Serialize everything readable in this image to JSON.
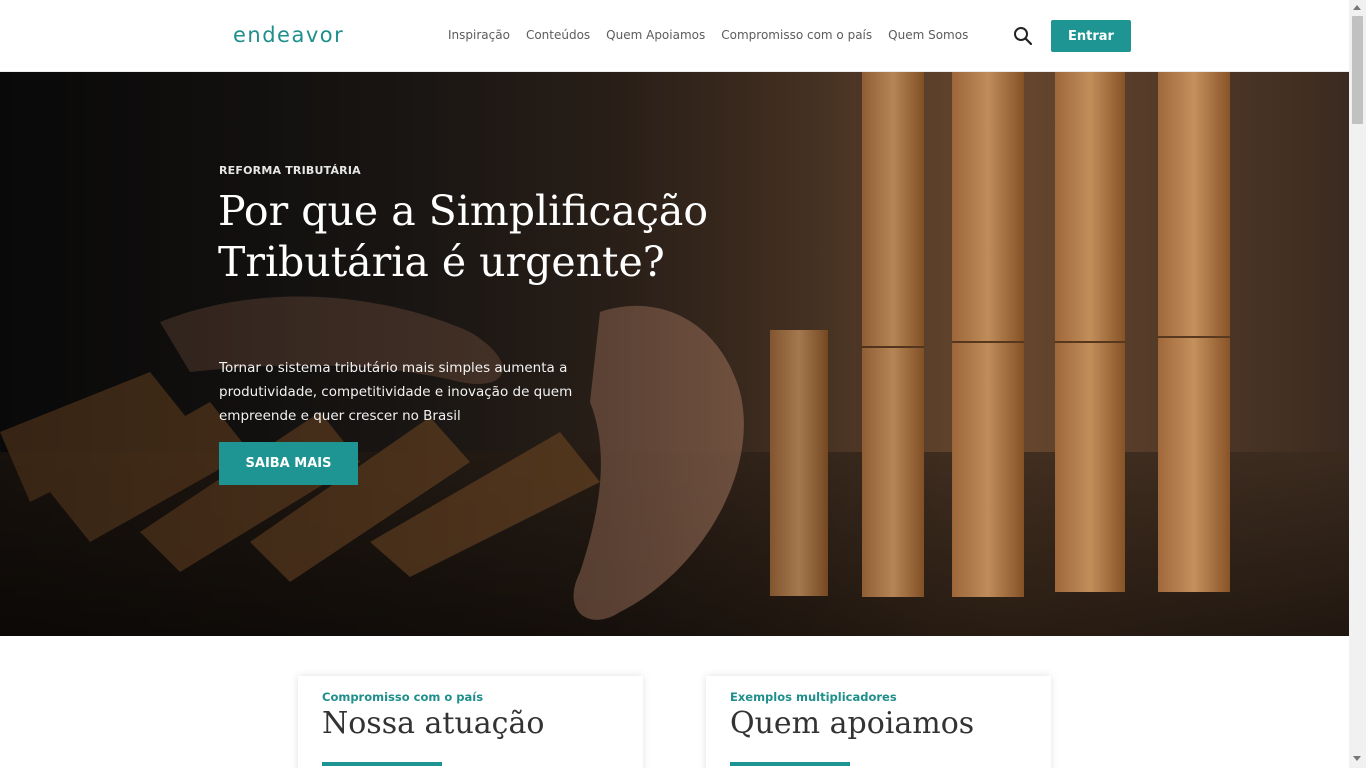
{
  "header": {
    "logo": "endeavor",
    "nav": [
      "Inspiração",
      "Conteúdos",
      "Quem Apoiamos",
      "Compromisso com o país",
      "Quem Somos"
    ],
    "search_icon": "search-icon",
    "login_label": "Entrar"
  },
  "hero": {
    "eyebrow": "REFORMA TRIBUTÁRIA",
    "title": "Por que a Simplificação Tributária é urgente?",
    "text": "Tornar o sistema tributário mais simples aumenta a produtividade, competitividade e inovação de quem empreende e quer crescer no Brasil",
    "cta": "SAIBA MAIS"
  },
  "cards": [
    {
      "eyebrow": "Compromisso com o país",
      "title": "Nossa atuação"
    },
    {
      "eyebrow": "Exemplos multiplicadores",
      "title": "Quem apoiamos"
    }
  ],
  "colors": {
    "accent": "#1f9593",
    "logo": "#1f8f8c"
  }
}
